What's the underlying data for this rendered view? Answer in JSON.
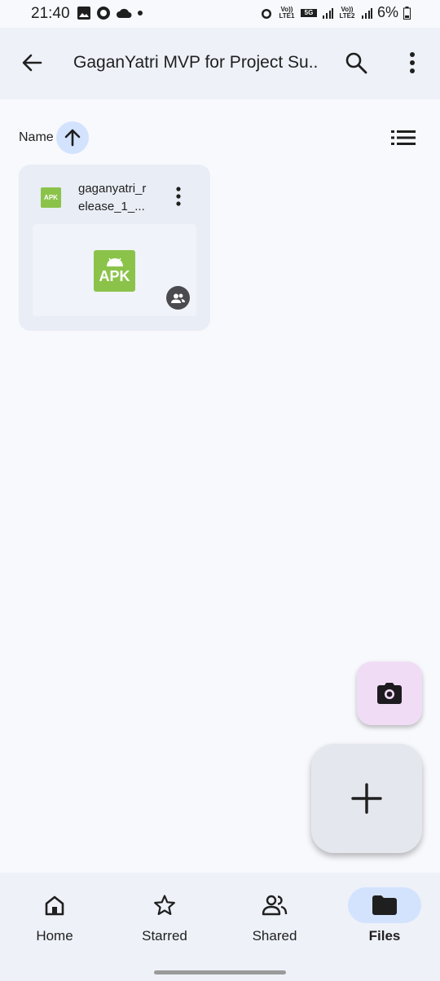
{
  "status_bar": {
    "time": "21:40",
    "battery": "6%",
    "network1": "Vo)) LTE1",
    "network2": "Vo)) LTE2",
    "network_5g": "5G"
  },
  "app_bar": {
    "title": "GaganYatri MVP for Project Su...",
    "back_icon": "arrow-back-icon",
    "search_icon": "search-icon",
    "more_icon": "more-vert-icon"
  },
  "sort": {
    "label": "Name",
    "direction_icon": "arrow-up-icon",
    "view_icon": "list-view-icon"
  },
  "files": [
    {
      "name": "gaganyatri_release_1_...",
      "name_line1": "gaganyatri_r",
      "name_line2": "elease_1_...",
      "type_badge": "APK",
      "thumbnail_label": "APK",
      "shared": true
    }
  ],
  "fabs": {
    "camera_icon": "camera-icon",
    "new_icon": "plus-icon"
  },
  "bottom_nav": {
    "items": [
      {
        "label": "Home",
        "icon": "home-icon",
        "active": false
      },
      {
        "label": "Starred",
        "icon": "star-icon",
        "active": false
      },
      {
        "label": "Shared",
        "icon": "people-icon",
        "active": false
      },
      {
        "label": "Files",
        "icon": "folder-icon",
        "active": true
      }
    ]
  },
  "colors": {
    "accent": "#d3e3fd",
    "apk_green": "#8bc34a",
    "camera_fab": "#f1dcf6"
  }
}
